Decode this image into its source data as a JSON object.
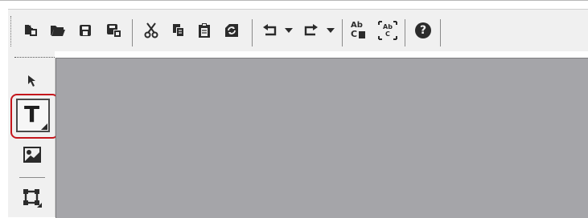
{
  "colors": {
    "toolbar_bg": "#f0f0f0",
    "canvas_bg": "#a5a5a9",
    "icon": "#2b2b2b",
    "highlight": "#c4161c"
  },
  "toolbar": {
    "buttons": [
      {
        "name": "new-icon"
      },
      {
        "name": "open-folder-icon"
      },
      {
        "name": "save-icon"
      },
      {
        "name": "save-as-icon"
      },
      {
        "name": "cut-icon"
      },
      {
        "name": "copy-icon"
      },
      {
        "name": "paste-icon"
      },
      {
        "name": "refresh-icon"
      },
      {
        "name": "undo-icon"
      },
      {
        "name": "undo-dropdown-icon"
      },
      {
        "name": "redo-icon"
      },
      {
        "name": "redo-dropdown-icon"
      },
      {
        "name": "font-color-icon"
      },
      {
        "name": "text-fit-icon"
      },
      {
        "name": "help-icon"
      }
    ],
    "font_icon_text": {
      "top": "Ab",
      "bottom": "C"
    },
    "fit_icon_text": {
      "top": "Ab",
      "bottom": "C"
    },
    "help_glyph": "?"
  },
  "sidebar": {
    "tools": [
      {
        "name": "select-tool",
        "icon": "pointer-arrow-icon"
      },
      {
        "name": "text-tool",
        "icon": "text-t-icon",
        "label": "T",
        "selected": true
      },
      {
        "name": "image-tool",
        "icon": "image-icon"
      },
      {
        "name": "shape-tool",
        "icon": "frame-box-icon"
      }
    ]
  }
}
